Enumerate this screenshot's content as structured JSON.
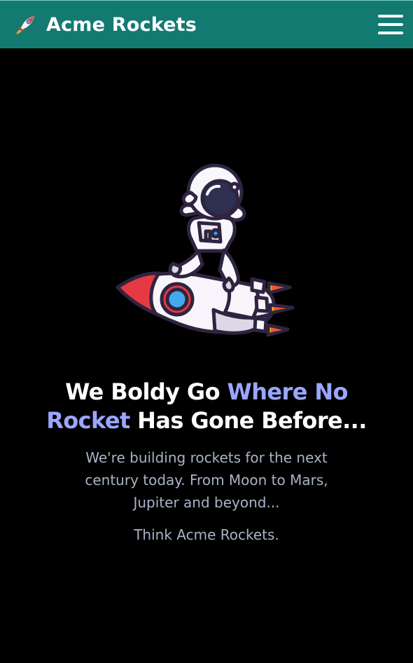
{
  "app": {
    "title": "Acme Rockets"
  },
  "navbar": {
    "brand": "Acme Rockets",
    "brand_icon": "rocket-icon",
    "menu_icon": "hamburger-menu-icon",
    "background": "#137a72"
  },
  "hero": {
    "title_part1": "We Boldy Go ",
    "title_highlight": "Where No Rocket",
    "title_part2": " Has Gone Before...",
    "copy": "We're building rockets for the next century today. From Moon to Mars, Jupiter and beyond...",
    "tagline": "Think Acme Rockets.",
    "image": "astronaut-on-rocket-illustration",
    "accent_color": "#9aa6ff"
  }
}
